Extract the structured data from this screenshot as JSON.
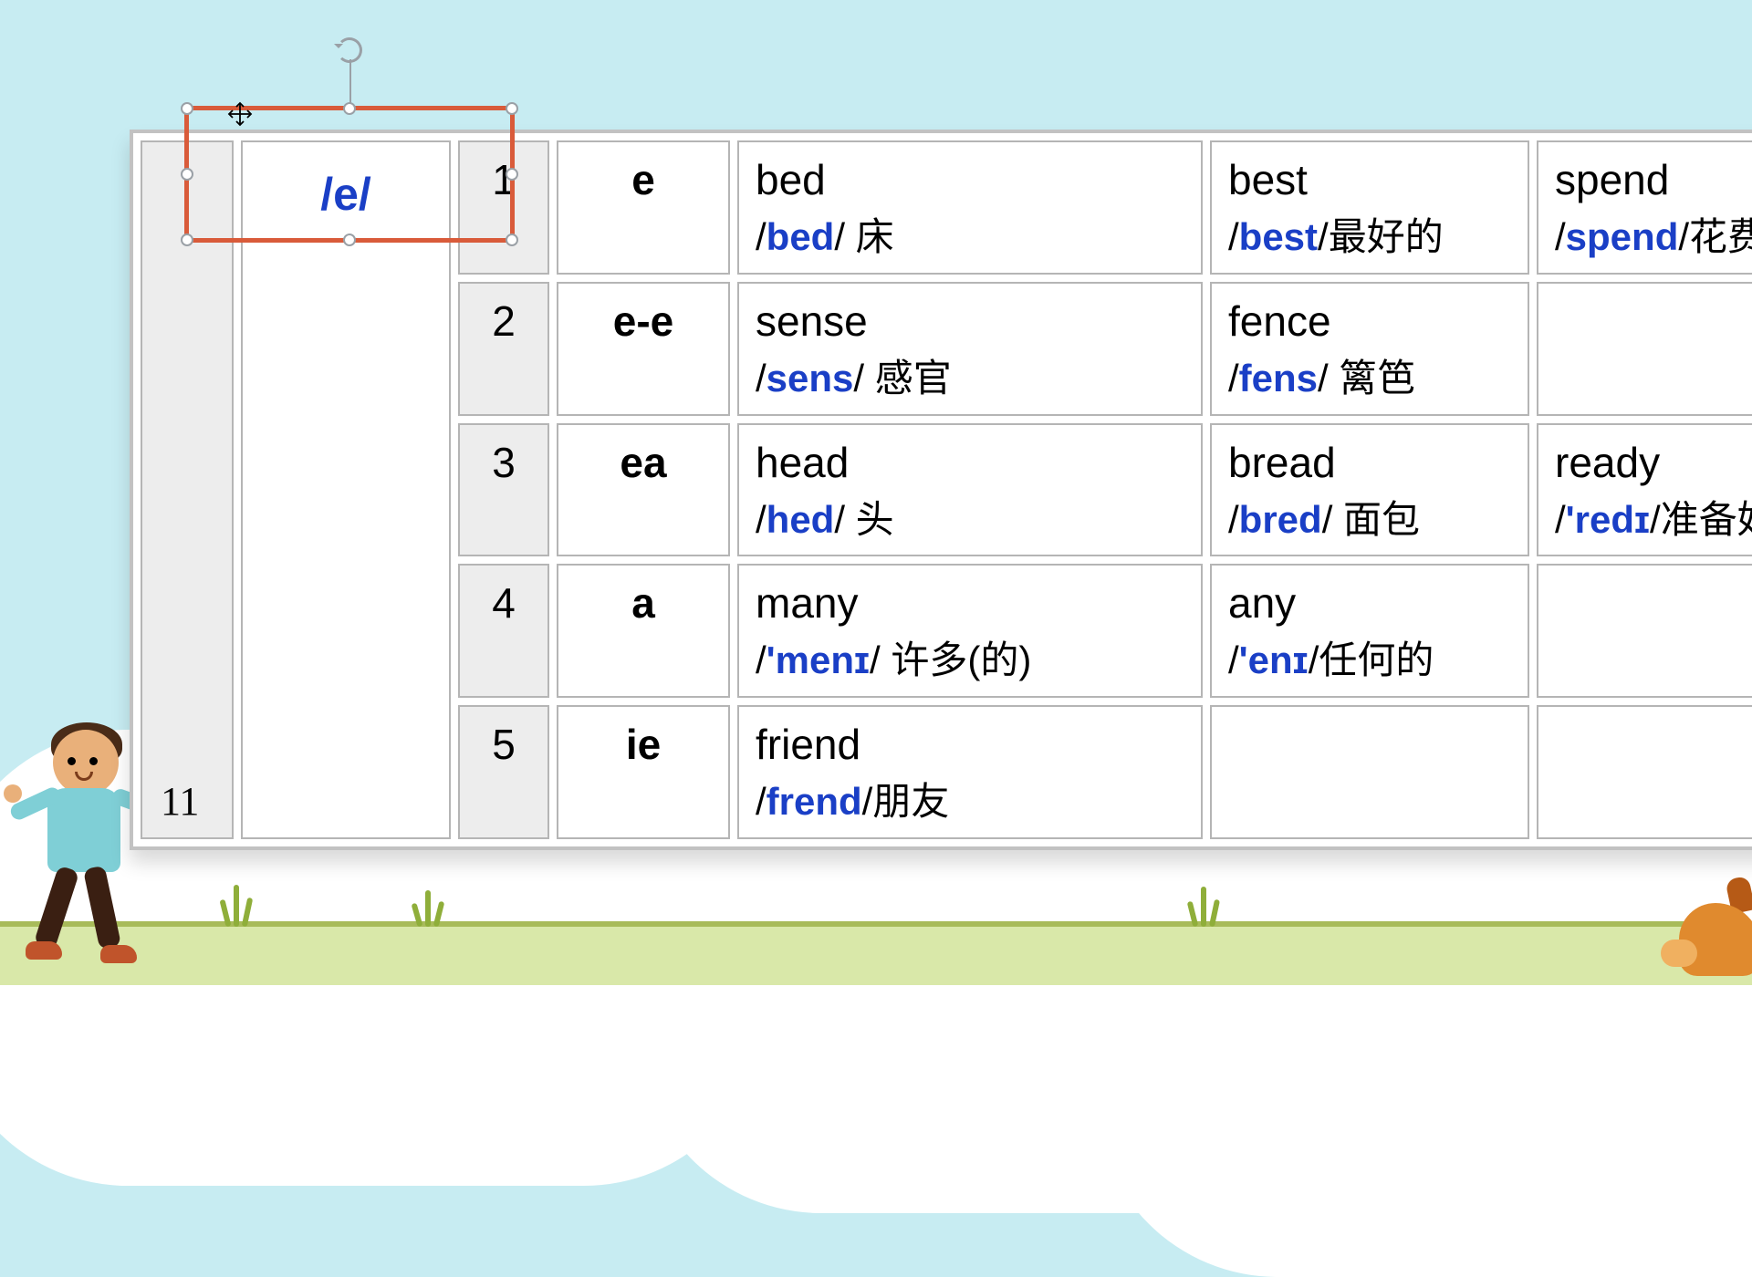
{
  "page_number": "11",
  "sound": "/e/",
  "selection": {
    "rotate_visible": true
  },
  "rows": [
    {
      "num": "1",
      "spelling": "e",
      "cells": [
        {
          "word": "bed",
          "ipa": "bed",
          "trans": " 床"
        },
        {
          "word": "best",
          "ipa": "best",
          "trans": "最好的"
        },
        {
          "word": "spend",
          "ipa": "spend",
          "trans": "花费"
        }
      ]
    },
    {
      "num": "2",
      "spelling": "e-e",
      "cells": [
        {
          "word": "sense",
          "ipa": "sens",
          "trans": " 感官"
        },
        {
          "word": "fence",
          "ipa": "fens",
          "trans": " 篱笆"
        },
        {
          "word": "",
          "ipa": "",
          "trans": ""
        }
      ]
    },
    {
      "num": "3",
      "spelling": "ea",
      "cells": [
        {
          "word": "head",
          "ipa": "hed",
          "trans": " 头"
        },
        {
          "word": "bread",
          "ipa": "bred",
          "trans": " 面包"
        },
        {
          "word": "ready",
          "ipa": "'redɪ",
          "trans": "准备好"
        }
      ]
    },
    {
      "num": "4",
      "spelling": "a",
      "cells": [
        {
          "word": "many",
          "ipa": "'menɪ",
          "trans": " 许多(的)"
        },
        {
          "word": "any",
          "ipa": "'enɪ",
          "trans": "任何的"
        },
        {
          "word": "",
          "ipa": "",
          "trans": ""
        }
      ]
    },
    {
      "num": "5",
      "spelling": "ie",
      "cells": [
        {
          "word": "friend",
          "ipa": "frend",
          "trans": "朋友"
        },
        {
          "word": "",
          "ipa": "",
          "trans": ""
        },
        {
          "word": "",
          "ipa": "",
          "trans": ""
        }
      ]
    }
  ]
}
